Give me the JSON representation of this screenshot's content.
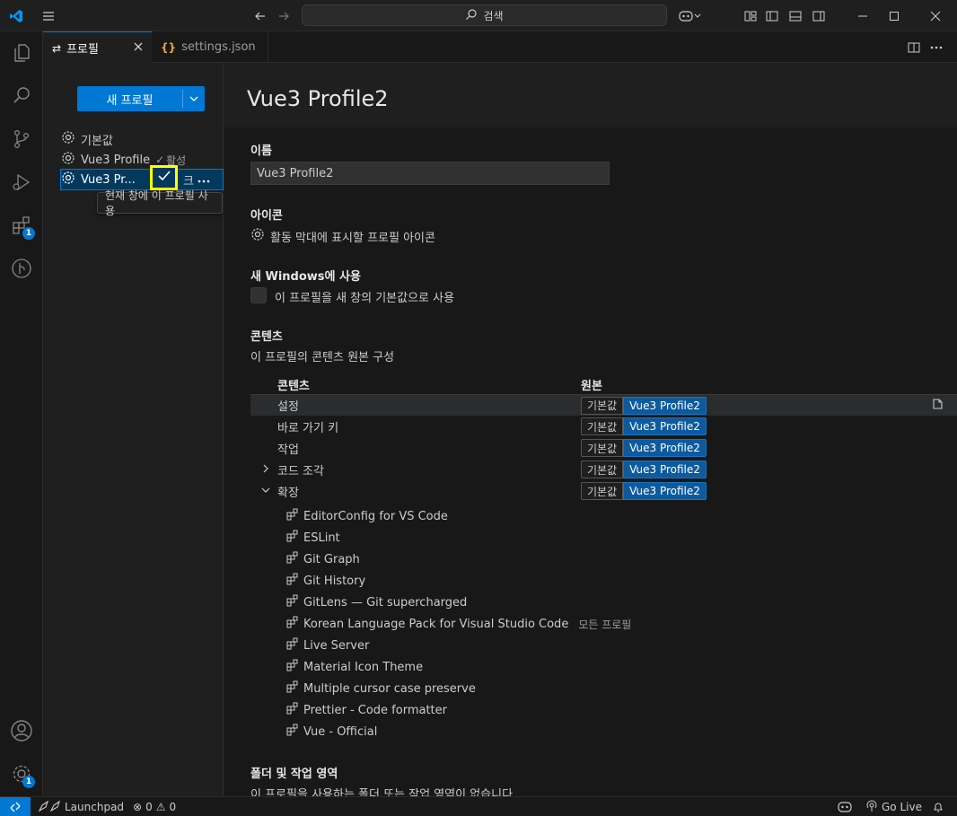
{
  "titlebar": {
    "search_label": "검색"
  },
  "tabs": [
    {
      "label": "프로필",
      "active": true
    },
    {
      "label": "settings.json",
      "active": false
    }
  ],
  "activity_badges": {
    "extensions": "1",
    "manage": "1"
  },
  "sidebar": {
    "new_profile_label": "새 프로필",
    "profiles": [
      {
        "label": "기본값"
      },
      {
        "label": "Vue3 Profile",
        "tag": "활성"
      },
      {
        "label": "Vue3 Pr...",
        "selected": true
      }
    ],
    "tooltip": "현재 창에 이 프로필 사용"
  },
  "main": {
    "title": "Vue3 Profile2",
    "name_label": "이름",
    "name_value": "Vue3 Profile2",
    "icon_label": "아이콘",
    "icon_desc": "활동 막대에 표시할 프로필 아이콘",
    "new_windows_label": "새 Windows에 사용",
    "new_windows_desc": "이 프로필을 새 창의 기본값으로 사용",
    "contents_label": "콘텐츠",
    "contents_desc": "이 프로필의 콘텐츠 원본 구성",
    "col_contents": "콘텐츠",
    "col_source": "원본",
    "rows": [
      {
        "name": "설정",
        "opt_a": "기본값",
        "opt_b": "Vue3 Profile2"
      },
      {
        "name": "바로 가기 키",
        "opt_a": "기본값",
        "opt_b": "Vue3 Profile2"
      },
      {
        "name": "작업",
        "opt_a": "기본값",
        "opt_b": "Vue3 Profile2"
      },
      {
        "name": "코드 조각",
        "opt_a": "기본값",
        "opt_b": "Vue3 Profile2"
      },
      {
        "name": "확장",
        "opt_a": "기본값",
        "opt_b": "Vue3 Profile2"
      }
    ],
    "extensions": [
      {
        "name": "EditorConfig for VS Code"
      },
      {
        "name": "ESLint"
      },
      {
        "name": "Git Graph"
      },
      {
        "name": "Git History"
      },
      {
        "name": "GitLens — Git supercharged"
      },
      {
        "name": "Korean Language Pack for Visual Studio Code",
        "extra": "모든 프로필"
      },
      {
        "name": "Live Server"
      },
      {
        "name": "Material Icon Theme"
      },
      {
        "name": "Multiple cursor case preserve"
      },
      {
        "name": "Prettier - Code formatter"
      },
      {
        "name": "Vue - Official"
      }
    ],
    "folders_label": "폴더 및 작업 영역",
    "folders_desc": "이 프로필을 사용하는 폴더 또는 작업 영역이 없습니다"
  },
  "statusbar": {
    "launchpad": "Launchpad",
    "errors": "0",
    "warnings": "0",
    "golive": "Go Live"
  },
  "colors": {
    "accent": "#0078d4",
    "highlight": "#ffff00"
  }
}
